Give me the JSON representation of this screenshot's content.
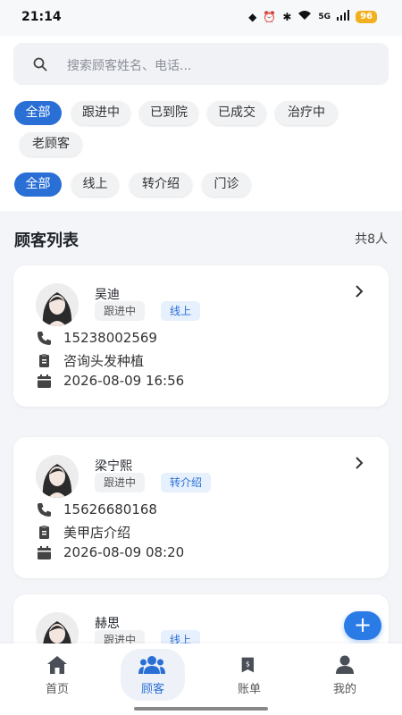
{
  "status_bar": {
    "time": "21:14",
    "network": "5G",
    "battery": "96"
  },
  "search": {
    "placeholder": "搜索顾客姓名、电话..."
  },
  "filters": {
    "status": [
      "全部",
      "跟进中",
      "已到院",
      "已成交",
      "治疗中",
      "老顾客"
    ],
    "source": [
      "全部",
      "线上",
      "转介绍",
      "门诊"
    ]
  },
  "list": {
    "title": "顾客列表",
    "count": "共8人"
  },
  "customers": [
    {
      "name": "吴迪",
      "status": "跟进中",
      "source": "线上",
      "phone": "15238002569",
      "note": "咨询头发种植",
      "date": "2026-08-09 16:56"
    },
    {
      "name": "梁宁熙",
      "status": "跟进中",
      "source": "转介绍",
      "phone": "15626680168",
      "note": "美甲店介绍",
      "date": "2026-08-09 08:20"
    },
    {
      "name": "赫思",
      "status": "跟进中",
      "source": "线上"
    }
  ],
  "fab": {
    "label": "+"
  },
  "tabs": {
    "home": "首页",
    "customers": "顾客",
    "bills": "账单",
    "mine": "我的"
  },
  "colors": {
    "accent": "#2a6fd6",
    "tag_source_bg": "#e7f0fd",
    "battery": "#f2b01e"
  }
}
